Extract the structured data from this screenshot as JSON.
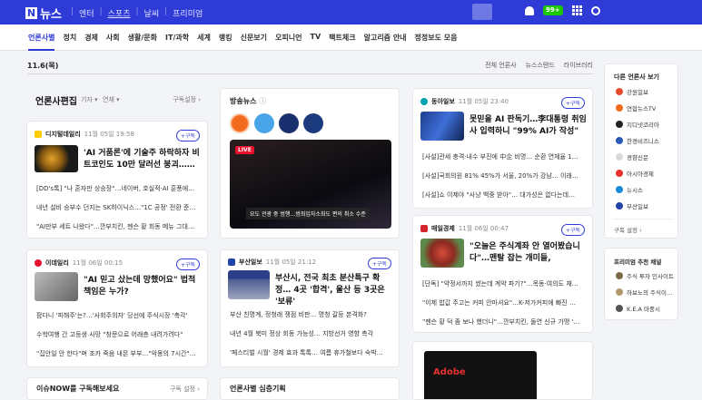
{
  "topbar": {
    "logo_n": "N",
    "logo_text": "뉴스",
    "nav": [
      "엔터",
      "스포츠",
      "날씨",
      "프리미엄"
    ],
    "mail_count": "99+"
  },
  "categories": [
    "언론사별",
    "정치",
    "경제",
    "사회",
    "생활/문화",
    "IT/과학",
    "세계",
    "랭킹",
    "신문보기",
    "오피니언",
    "TV",
    "팩트체크",
    "알고리즘 안내",
    "정정보도 모음"
  ],
  "date": "11.6(목)",
  "view_tabs": [
    "전체 언론사",
    "뉴스스탠드",
    "라이브러리"
  ],
  "edit_section": {
    "title": "언론사편집",
    "filter1": "기자",
    "filter2": "연재",
    "settings": "구독설정"
  },
  "cards": [
    {
      "press": "디지털데일리",
      "time": "11월 05일 19:58",
      "subscribe": "+구독",
      "headline": "'AI 거품론'에 기술주 하락하자 비트코인도 10만 달러선 붕괴……",
      "lines": [
        "[DD's톡] \"나 혼자만 상승장\"…네이버, 호실적·AI 훈풍에…",
        "내년 설비 승부수 던지는 SK하이닉스…\"1C 공정' 전환 준…",
        "\"AI만부 세트 나왔다\"…깐부치킨, 젠슨 황 회동 메뉴 그대…"
      ]
    },
    {
      "press": "이데일리",
      "time": "11월 06일 00:15",
      "subscribe": "+구독",
      "headline": "\"AI 믿고 샀는데 망했어요\" 법적 책임은 누가?",
      "lines": [
        "팜다니 '피해주'는?…'사회주의자' 당선에 주식시장 '촉각'",
        "수학여행 간 고등생 사망 \"창문으로 어래층 내려가려다\"",
        "\"집안일 안 한다\"며 조카 죽음 내몬 부부…\"악몽의 7시간\"…"
      ]
    },
    {
      "press": "동아일보",
      "time": "11월 05일 23:40",
      "subscribe": "+구독",
      "headline": "못믿을 AI 판독기…李대통령 취임사 입력하니 \"99% AI가 작성\"",
      "lines": [
        "[사설]관세 충격·내수 부진에 中企 비명… 순환 연체율 1…",
        "[사설]국회의원 81% 45%가 서울, 20%가 강남… 이래…",
        "[사설]쇼 이제야 \"사냥 백중 받아\"… 대가성은 없다는데…"
      ]
    },
    {
      "press": "부산일보",
      "time": "11월 05일 21:12",
      "subscribe": "+구독",
      "headline": "부산시, 전국 최초 분산특구 확정… 4곳 '합격', 울산 등 3곳은 '보류'",
      "lines": [
        "부산 친명계, 정청래 쟁점 비판… 명청 갈등 본격화?",
        "내년 4월 북미 정상 회동 가능성… 지방선거 영향 촉각",
        "'페스티벌 시월' 경제 효과 톡톡… 여름 휴가철보다 숙박…"
      ]
    },
    {
      "press": "매일경제",
      "time": "11월 06일 00:47",
      "subscribe": "+구독",
      "headline": "\"오늘은 주식계좌 안 열어봤습니다\"…맨탈 잡는 개미들,",
      "lines": [
        "[단독] \"약정서까지 썼는데 계약 파기?\"…목동·여의도 재…",
        "\"이제 밥값 주고는 커피 안마셔요\"…K-저가커피에 빠진 …",
        "\"젠슨 황 덕 좀 보나 했더니\"…깐부치킨, 돌연 신규 가맹 '…"
      ]
    }
  ],
  "broadcast": {
    "title": "방송뉴스",
    "info": "ⓘ",
    "channels": [
      "연합뉴스TV",
      "YTN",
      "KBS NEWS",
      "MBC NEWS"
    ],
    "live": "LIVE",
    "caption": "요도 관광 중 범행…범죄입자소화도 편의 취소 수준"
  },
  "bottom": {
    "issue": "이슈NOW를 구독해보세요",
    "issue_settings": "구독 설정",
    "opinion": "언론사별 심층기획",
    "ad_text": "Adobe"
  },
  "right_panel": {
    "title": "다른 언론사 보기",
    "items": [
      "강원일보",
      "연합뉴스TV",
      "지디넷코리아",
      "한경비즈니스",
      "경향신문",
      "아시아경제",
      "뉴시스",
      "부산일보"
    ],
    "more": "구독 설정",
    "chan_title": "프리미엄 추천 채널",
    "channels": [
      "주식 투자 인사이트",
      "하보노의 주식이…",
      "K.E.A 마중시"
    ]
  },
  "colors": {
    "brand": "#2f3bd6",
    "live": "#e8112d"
  }
}
